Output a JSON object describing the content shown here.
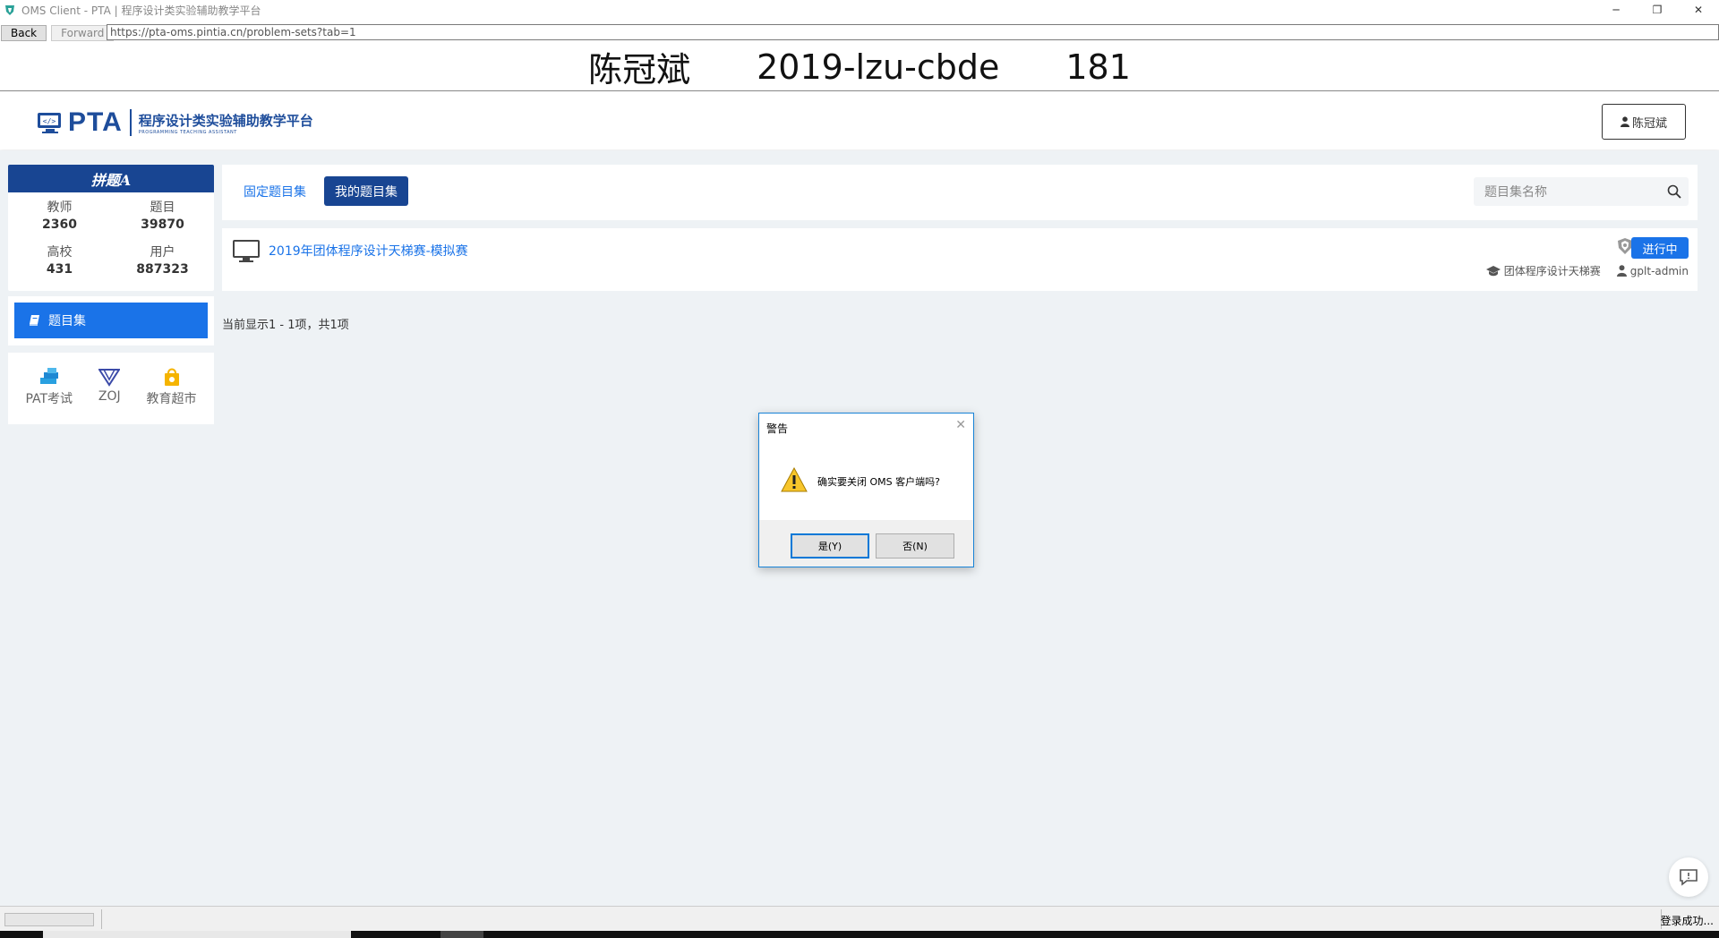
{
  "window": {
    "title": "OMS Client - PTA | 程序设计类实验辅助教学平台",
    "minimize": "─",
    "restore": "❐",
    "close": "✕"
  },
  "nav": {
    "back": "Back",
    "forward": "Forward",
    "url": "https://pta-oms.pintia.cn/problem-sets?tab=1"
  },
  "banner": {
    "name": "陈冠斌",
    "exam_id": "2019-lzu-cbde",
    "seat": "181"
  },
  "header": {
    "logo_text": "PTA",
    "logo_cn": "程序设计类实验辅助教学平台",
    "logo_en": "PROGRAMMING TEACHING ASSISTANT",
    "user": "陈冠斌"
  },
  "sidebar": {
    "brand": "拼题A",
    "stats": [
      {
        "label": "教师",
        "value": "2360"
      },
      {
        "label": "题目",
        "value": "39870"
      },
      {
        "label": "高校",
        "value": "431"
      },
      {
        "label": "用户",
        "value": "887323"
      }
    ],
    "menu_item": "题目集",
    "links": [
      {
        "label": "PAT考试"
      },
      {
        "label": "ZOJ"
      },
      {
        "label": "教育超市"
      }
    ]
  },
  "tabs": {
    "fixed": "固定题目集",
    "mine": "我的题目集",
    "search_placeholder": "题目集名称"
  },
  "problem_set": {
    "title": "2019年团体程序设计天梯赛-模拟赛",
    "status": "进行中",
    "category": "团体程序设计天梯赛",
    "owner": "gplt-admin"
  },
  "count_text": "当前显示1 - 1项，共1项",
  "status_bar": {
    "text": "登录成功..."
  },
  "dialog": {
    "title": "警告",
    "message": "确实要关闭 OMS 客户端吗?",
    "yes": "是(Y)",
    "no": "否(N)",
    "close": "✕"
  },
  "colors": {
    "primary": "#1a73e8",
    "dark_blue": "#184592",
    "background": "#eef2f5"
  }
}
